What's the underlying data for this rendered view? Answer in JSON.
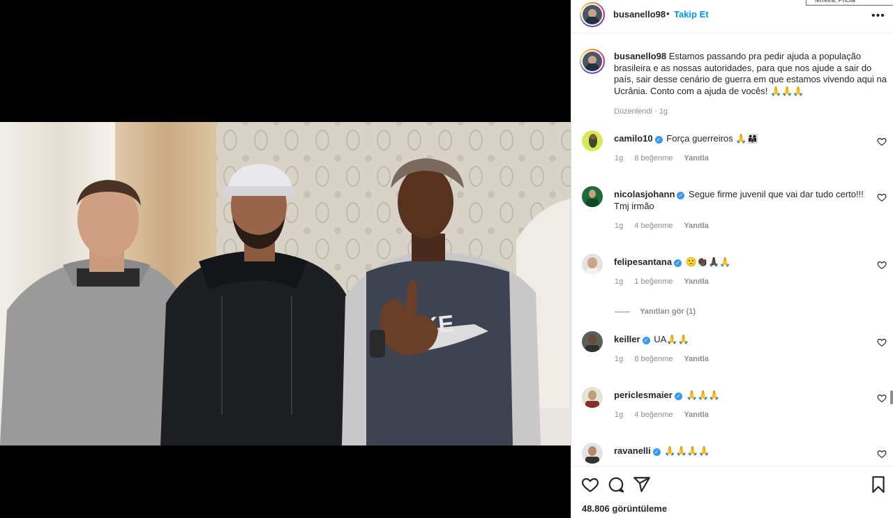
{
  "header": {
    "username": "busanello98",
    "separator": "•",
    "follow_label": "Takip Et",
    "more_label": "•••",
    "tooltip_text": "ferreira, Pricila"
  },
  "caption": {
    "username": "busanello98",
    "text": "Estamos passando pra pedir ajuda a população brasileira e as nossas autoridades, para que nos ajude a sair do país, sair desse cenário de guerra em que estamos vivendo aqui na Ucrânia. Conto com a ajuda de vocês! 🙏🙏🙏",
    "meta": "Düzenlendi · 1g"
  },
  "comments": [
    {
      "username": "camilo10",
      "verified": true,
      "text": "Força guerreiros 🙏👨‍👩‍👧",
      "time": "1g",
      "likes": "8 beğenme",
      "reply": "Yanıtla"
    },
    {
      "username": "nicolasjohann",
      "verified": true,
      "text": "Segue firme juvenil que vai dar tudo certo!!! Tmj irmão",
      "time": "1g",
      "likes": "4 beğenme",
      "reply": "Yanıtla"
    },
    {
      "username": "felipesantana",
      "verified": true,
      "text": "🙁👏🏿🙏🏿🙏",
      "time": "1g",
      "likes": "1 beğenme",
      "reply": "Yanıtla",
      "view_replies": "Yanıtları gör (1)"
    },
    {
      "username": "keiller",
      "verified": true,
      "text": "UA🙏🙏",
      "time": "1g",
      "likes": "8 beğenme",
      "reply": "Yanıtla"
    },
    {
      "username": "periclesmaier",
      "verified": true,
      "text": "🙏🙏🙏",
      "time": "1g",
      "likes": "4 beğenme",
      "reply": "Yanıtla"
    },
    {
      "username": "ravanelli",
      "verified": true,
      "text": "🙏🙏🙏🙏",
      "time": "",
      "likes": "",
      "reply": ""
    }
  ],
  "actions": {
    "views": "48.806 görüntüleme",
    "icons": [
      "heart-icon",
      "comment-icon",
      "share-icon",
      "bookmark-icon"
    ]
  },
  "colors": {
    "link_blue": "#0095f6",
    "verified_blue": "#3897f0",
    "meta_gray": "#8e8e8e",
    "text": "#262626"
  }
}
